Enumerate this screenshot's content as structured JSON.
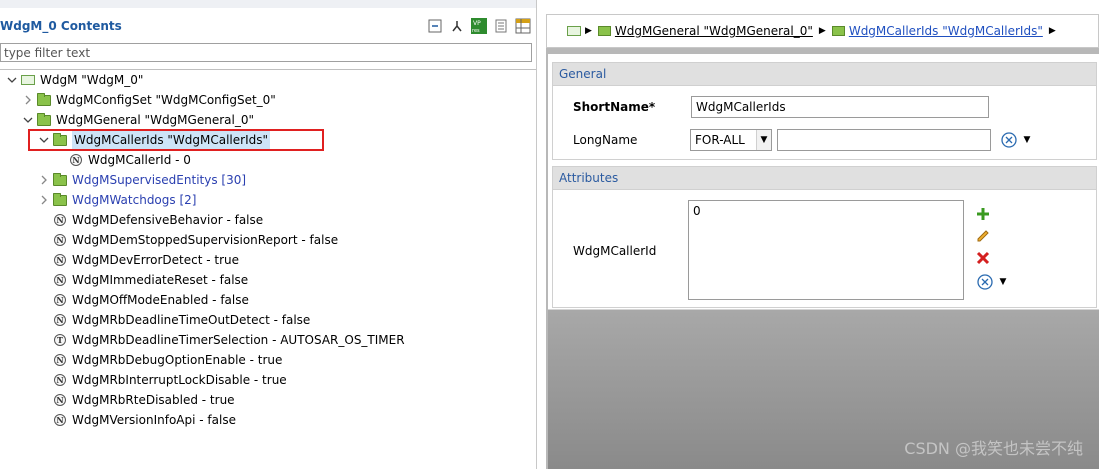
{
  "left": {
    "view_title": "WdgM_0 Contents",
    "filter_placeholder": "type filter text",
    "toolbar_icons": [
      "collapse-all-icon",
      "link-icon",
      "vp-res-icon",
      "document-icon",
      "table-icon"
    ],
    "tree": [
      {
        "label": "WdgM \"WdgM_0\"",
        "twisty": "expanded",
        "icon": "module",
        "depth": 0
      },
      {
        "label": "WdgMConfigSet \"WdgMConfigSet_0\"",
        "twisty": "collapsed",
        "icon": "folder",
        "depth": 1
      },
      {
        "label": "WdgMGeneral \"WdgMGeneral_0\"",
        "twisty": "expanded",
        "icon": "folder",
        "depth": 1
      },
      {
        "label": "WdgMCallerIds \"WdgMCallerIds\"",
        "twisty": "expanded",
        "icon": "folder",
        "depth": 2,
        "selected": true
      },
      {
        "label": "WdgMCallerId - 0",
        "twisty": "none",
        "icon": "N",
        "depth": 3
      },
      {
        "label": "WdgMSupervisedEntitys [30]",
        "twisty": "collapsed",
        "icon": "folder",
        "depth": 2,
        "blue": true
      },
      {
        "label": "WdgMWatchdogs [2]",
        "twisty": "collapsed",
        "icon": "folder",
        "depth": 2,
        "blue": true
      },
      {
        "label": "WdgMDefensiveBehavior - false",
        "twisty": "none",
        "icon": "N",
        "depth": 2
      },
      {
        "label": "WdgMDemStoppedSupervisionReport - false",
        "twisty": "none",
        "icon": "N",
        "depth": 2
      },
      {
        "label": "WdgMDevErrorDetect - true",
        "twisty": "none",
        "icon": "N",
        "depth": 2
      },
      {
        "label": "WdgMImmediateReset - false",
        "twisty": "none",
        "icon": "N",
        "depth": 2
      },
      {
        "label": "WdgMOffModeEnabled - false",
        "twisty": "none",
        "icon": "N",
        "depth": 2
      },
      {
        "label": "WdgMRbDeadlineTimeOutDetect - false",
        "twisty": "none",
        "icon": "N",
        "depth": 2
      },
      {
        "label": "WdgMRbDeadlineTimerSelection - AUTOSAR_OS_TIMER",
        "twisty": "none",
        "icon": "T",
        "depth": 2
      },
      {
        "label": "WdgMRbDebugOptionEnable - true",
        "twisty": "none",
        "icon": "N",
        "depth": 2
      },
      {
        "label": "WdgMRbInterruptLockDisable - true",
        "twisty": "none",
        "icon": "N",
        "depth": 2
      },
      {
        "label": "WdgMRbRteDisabled - true",
        "twisty": "none",
        "icon": "N",
        "depth": 2
      },
      {
        "label": "WdgMVersionInfoApi - false",
        "twisty": "none",
        "icon": "N",
        "depth": 2
      }
    ]
  },
  "right": {
    "breadcrumb": {
      "item1": "WdgMGeneral \"WdgMGeneral_0\"",
      "item2": "WdgMCallerIds \"WdgMCallerIds\""
    },
    "general": {
      "header": "General",
      "shortname_label": "ShortName*",
      "shortname_value": "WdgMCallerIds",
      "longname_label": "LongName",
      "lang_value": "FOR-ALL",
      "longname_value": ""
    },
    "attributes": {
      "header": "Attributes",
      "callerid_label": "WdgMCallerId",
      "callerid_values": [
        "0"
      ]
    }
  },
  "watermark": "CSDN @我笑也未尝不纯",
  "colors": {
    "accent": "#1f5aa0",
    "folder": "#8ac24a",
    "highlight": "#e02020",
    "selection": "#cde4f7"
  }
}
